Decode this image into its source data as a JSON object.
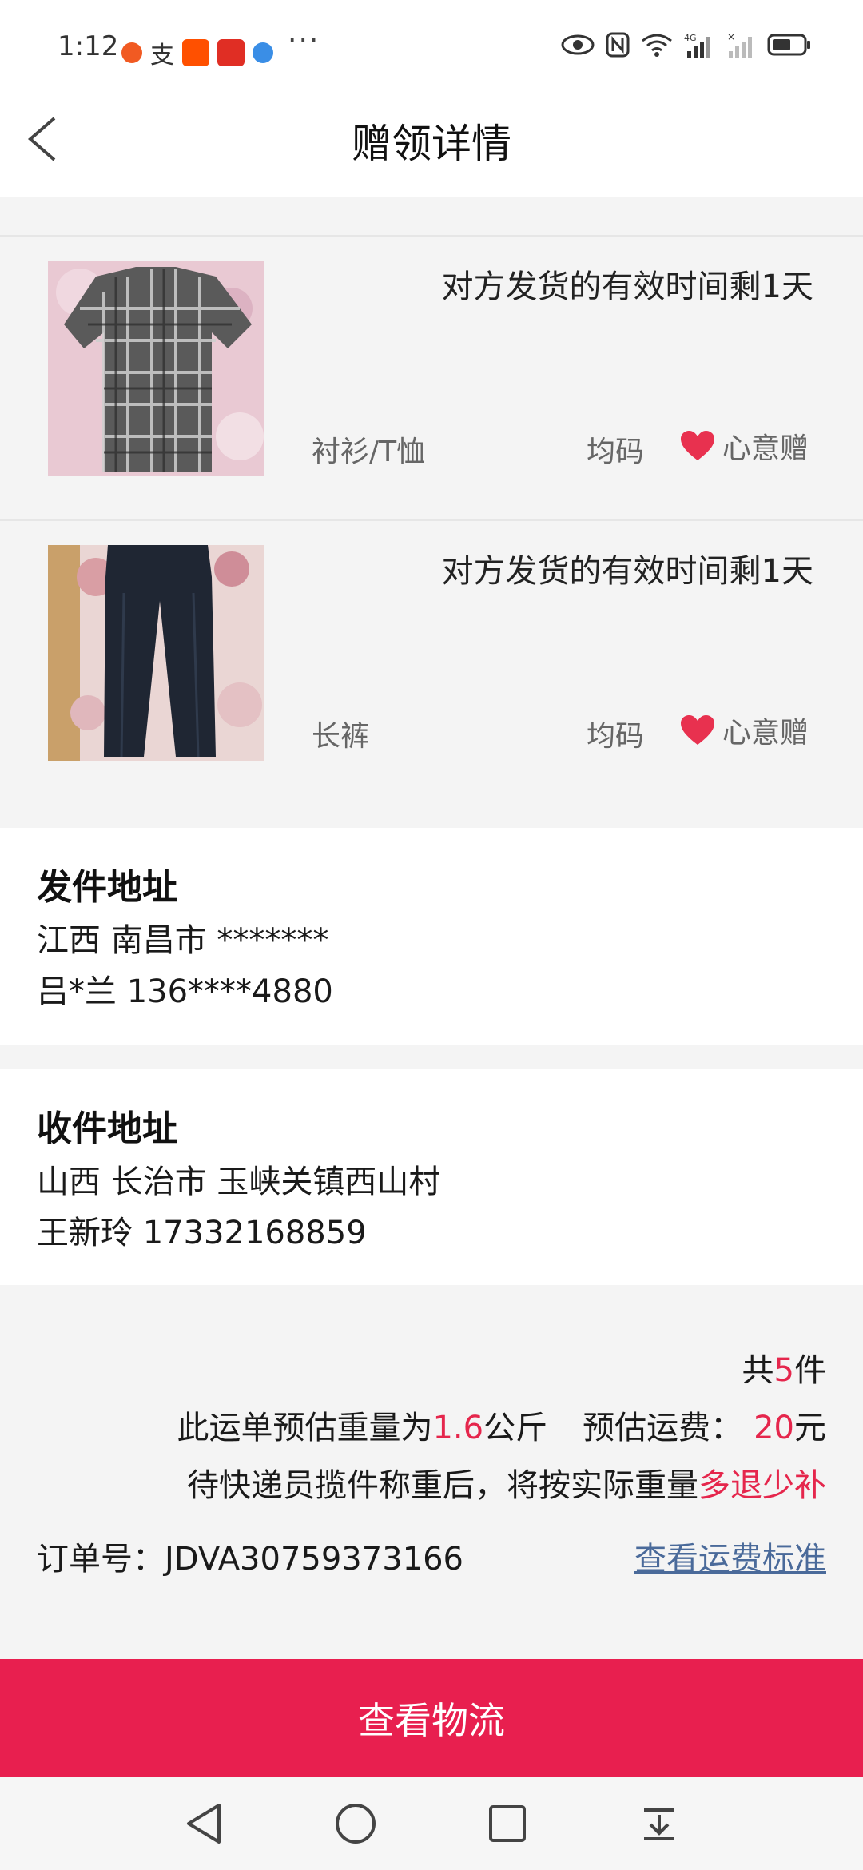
{
  "status_bar": {
    "time": "1:12",
    "more": "···",
    "icons": [
      "eye-icon",
      "nfc-icon",
      "wifi-icon",
      "signal-4g-icon",
      "signal-icon",
      "battery-icon"
    ]
  },
  "header": {
    "title": "赠领详情"
  },
  "items": [
    {
      "deadline": "对方发货的有效时间剩1天",
      "category": "衬衫/T恤",
      "size": "均码",
      "tag": "心意赠"
    },
    {
      "deadline": "对方发货的有效时间剩1天",
      "category": "长裤",
      "size": "均码",
      "tag": "心意赠"
    }
  ],
  "sender": {
    "title": "发件地址",
    "region": "江西 南昌市 *******",
    "contact": "吕*兰 136****4880"
  },
  "receiver": {
    "title": "收件地址",
    "region": "山西 长治市 玉峡关镇西山村",
    "contact": "王新玲 17332168859"
  },
  "summary": {
    "count_prefix": "共",
    "count": "5",
    "count_suffix": "件",
    "weight_prefix": "此运单预估重量为",
    "weight": "1.6",
    "weight_unit": "公斤",
    "fee_prefix": "预估运费：",
    "fee": "20",
    "fee_unit": "元",
    "note_prefix": "待快递员揽件称重后，将按实际重量",
    "note_accent": "多退少补",
    "order_label": "订单号：JDVA30759373166",
    "fee_standard_link": "查看运费标准"
  },
  "action": {
    "logistics_label": "查看物流"
  },
  "colors": {
    "accent": "#e5264c",
    "button": "#e81f4f",
    "link": "#4a6a9a"
  }
}
